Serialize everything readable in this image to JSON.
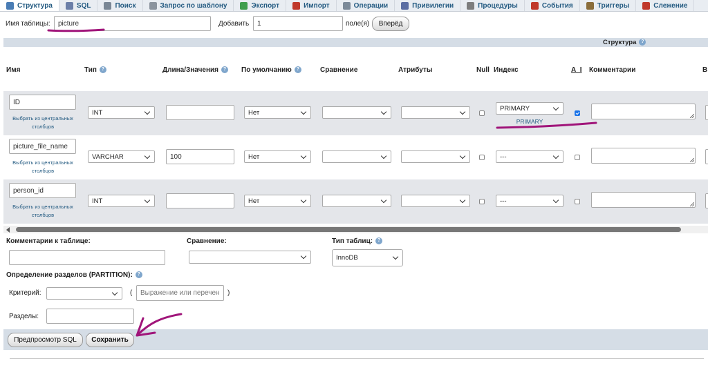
{
  "tabs": [
    {
      "label": "Структура",
      "icon": "structure-icon",
      "color": "#4a7db5"
    },
    {
      "label": "SQL",
      "icon": "sql-icon",
      "color": "#6b7fa8"
    },
    {
      "label": "Поиск",
      "icon": "search-icon",
      "color": "#7a8795"
    },
    {
      "label": "Запрос по шаблону",
      "icon": "query-icon",
      "color": "#8b949e"
    },
    {
      "label": "Экспорт",
      "icon": "export-icon",
      "color": "#3f9e4d"
    },
    {
      "label": "Импорт",
      "icon": "import-icon",
      "color": "#c0392b"
    },
    {
      "label": "Операции",
      "icon": "wrench-icon",
      "color": "#7c8a99"
    },
    {
      "label": "Привилегии",
      "icon": "privileges-icon",
      "color": "#5b6ea3"
    },
    {
      "label": "Процедуры",
      "icon": "procedures-icon",
      "color": "#7d7d7d"
    },
    {
      "label": "События",
      "icon": "events-icon",
      "color": "#c0392b"
    },
    {
      "label": "Триггеры",
      "icon": "triggers-icon",
      "color": "#8a6d3b"
    },
    {
      "label": "Слежение",
      "icon": "tracking-icon",
      "color": "#c0392b"
    }
  ],
  "header": {
    "table_name_label": "Имя таблицы:",
    "table_name_value": "picture",
    "add_label": "Добавить",
    "add_count": "1",
    "fields_label": "поле(я)",
    "go_button": "Вперёд"
  },
  "structure_title": "Структура",
  "columns": {
    "name": "Имя",
    "type": "Тип",
    "length": "Длина/Значения",
    "default": "По умолчанию",
    "collation": "Сравнение",
    "attributes": "Атрибуты",
    "null": "Null",
    "index": "Индекс",
    "ai": "A_I",
    "comments": "Комментарии",
    "cut": "В"
  },
  "pick_central_link": "Выбрать из центральных столбцов",
  "rows": [
    {
      "name": "ID",
      "type": "INT",
      "length": "",
      "default": "Нет",
      "collation": "",
      "attributes": "",
      "null": false,
      "index": "PRIMARY",
      "index_note": "PRIMARY",
      "ai": true,
      "comment": ""
    },
    {
      "name": "picture_file_name",
      "type": "VARCHAR",
      "length": "100",
      "default": "Нет",
      "collation": "",
      "attributes": "",
      "null": false,
      "index": "---",
      "index_note": "",
      "ai": false,
      "comment": ""
    },
    {
      "name": "person_id",
      "type": "INT",
      "length": "",
      "default": "Нет",
      "collation": "",
      "attributes": "",
      "null": false,
      "index": "---",
      "index_note": "",
      "ai": false,
      "comment": ""
    }
  ],
  "footer": {
    "table_comments_label": "Комментарии к таблице:",
    "table_comments_value": "",
    "collation_label": "Сравнение:",
    "collation_value": "",
    "engine_label": "Тип таблиц:",
    "engine_value": "InnoDB",
    "partition_label": "Определение разделов (PARTITION):",
    "criteria_label": "Критерий:",
    "criteria_value": "",
    "paren_open": "(",
    "expression_placeholder": "Выражение или перечень",
    "paren_close": ")",
    "partitions_label": "Разделы:",
    "partitions_value": "",
    "preview_sql_button": "Предпросмотр SQL",
    "save_button": "Сохранить"
  },
  "colors": {
    "accent": "#235a81",
    "row_shade": "#e4e6ea",
    "annotation": "#a0157a",
    "section_bar": "#d5dde6"
  }
}
